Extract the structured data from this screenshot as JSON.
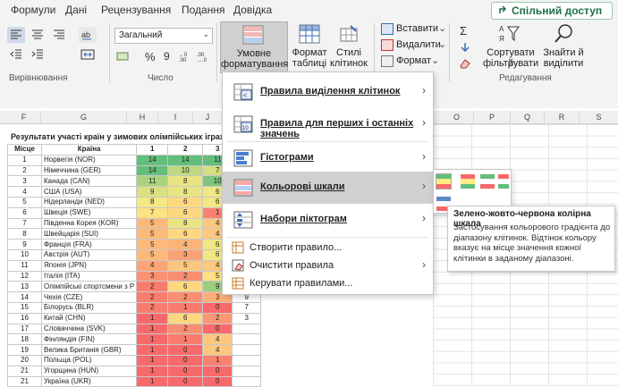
{
  "tabs": [
    "Формули",
    "Дані",
    "Рецензування",
    "Подання",
    "Довідка"
  ],
  "share_label": "Спільний доступ",
  "ribbon": {
    "number_format": "Загальний",
    "group_alignment": "Вирівнювання",
    "group_number": "Число",
    "group_editing": "Редагування",
    "conditional_formatting": [
      "Умовне",
      "форматування"
    ],
    "format_as_table": [
      "Формат",
      "таблиці"
    ],
    "cell_styles": [
      "Стилі",
      "клітинок"
    ],
    "insert": "Вставити",
    "delete": "Видалити",
    "format": "Формат",
    "sort_filter": [
      "Сортувати й",
      "фільтрувати"
    ],
    "find_select": [
      "Знайти й",
      "виділити"
    ]
  },
  "columns": [
    "F",
    "G",
    "H",
    "I",
    "J",
    "O",
    "P",
    "Q",
    "R",
    "S"
  ],
  "sheet": {
    "title": "Результати участі країн у зимових олімпійських іграх у",
    "headers": [
      "Місце",
      "Країна",
      "1",
      "2",
      "3"
    ],
    "rows": [
      {
        "place": "1",
        "country": "Норвегія (NOR)",
        "g": "14",
        "s": "14",
        "b": "11"
      },
      {
        "place": "2",
        "country": "Німеччина (GER)",
        "g": "14",
        "s": "10",
        "b": "7"
      },
      {
        "place": "3",
        "country": "Канада (CAN)",
        "g": "11",
        "s": "8",
        "b": "10"
      },
      {
        "place": "4",
        "country": "США (USA)",
        "g": "9",
        "s": "8",
        "b": "6"
      },
      {
        "place": "5",
        "country": "Нідерланди (NED)",
        "g": "8",
        "s": "6",
        "b": "6"
      },
      {
        "place": "6",
        "country": "Швеція (SWE)",
        "g": "7",
        "s": "6",
        "b": "1"
      },
      {
        "place": "7",
        "country": "Південна Корея (KOR)",
        "g": "5",
        "s": "8",
        "b": "4"
      },
      {
        "place": "8",
        "country": "Швейцарія (SUI)",
        "g": "5",
        "s": "6",
        "b": "4"
      },
      {
        "place": "9",
        "country": "Франція (FRA)",
        "g": "5",
        "s": "4",
        "b": "6"
      },
      {
        "place": "10",
        "country": "Австрія (AUT)",
        "g": "5",
        "s": "3",
        "b": "6"
      },
      {
        "place": "11",
        "country": "Японія (JPN)",
        "g": "4",
        "s": "5",
        "b": "4"
      },
      {
        "place": "12",
        "country": "Італія (ITA)",
        "g": "3",
        "s": "2",
        "b": "5"
      },
      {
        "place": "13",
        "country": "Олімпійські спортсмени з Р",
        "g": "2",
        "s": "6",
        "b": "9"
      },
      {
        "place": "14",
        "country": "Чехія (CZE)",
        "g": "2",
        "s": "2",
        "b": "3"
      },
      {
        "place": "15",
        "country": "Білорусь (BLR)",
        "g": "2",
        "s": "1",
        "b": "0"
      },
      {
        "place": "16",
        "country": "Китай (CHN)",
        "g": "1",
        "s": "6",
        "b": "2"
      },
      {
        "place": "17",
        "country": "Словаччина (SVK)",
        "g": "1",
        "s": "2",
        "b": "0"
      },
      {
        "place": "18",
        "country": "Фінляндія (FIN)",
        "g": "1",
        "s": "1",
        "b": "4"
      },
      {
        "place": "19",
        "country": "Велика Британія (GBR)",
        "g": "1",
        "s": "0",
        "b": "4"
      },
      {
        "place": "20",
        "country": "Польща (POL)",
        "g": "1",
        "s": "0",
        "b": "1"
      },
      {
        "place": "21",
        "country": "Угорщина (HUN)",
        "g": "1",
        "s": "0",
        "b": "0"
      },
      {
        "place": "21",
        "country": "Україна (UKR)",
        "g": "1",
        "s": "0",
        "b": "0"
      }
    ],
    "extra_col_values": [
      "9",
      "7",
      "3"
    ]
  },
  "menu": {
    "items": [
      {
        "label": "Правила виділення клітинок"
      },
      {
        "label": "Правила для перших і останніх значень"
      },
      {
        "label": "Гістограми"
      },
      {
        "label": "Кольорові шкали"
      },
      {
        "label": "Набори піктограм"
      }
    ],
    "commands": [
      "Створити правило...",
      "Очистити правила",
      "Керувати правилами..."
    ]
  },
  "tooltip": {
    "title": "Зелено-жовто-червона колірна шкала",
    "body": "Застосування кольорового градієнта до діапазону клітинок. Відтінок кольору вказує на місце значення кожної клітинки в заданому діапазоні."
  },
  "colors": {
    "accent": "#1e7145",
    "highlight": "#d0d0d0",
    "green": "#63be7b",
    "yellow": "#ffeb84",
    "red": "#f8696b"
  }
}
